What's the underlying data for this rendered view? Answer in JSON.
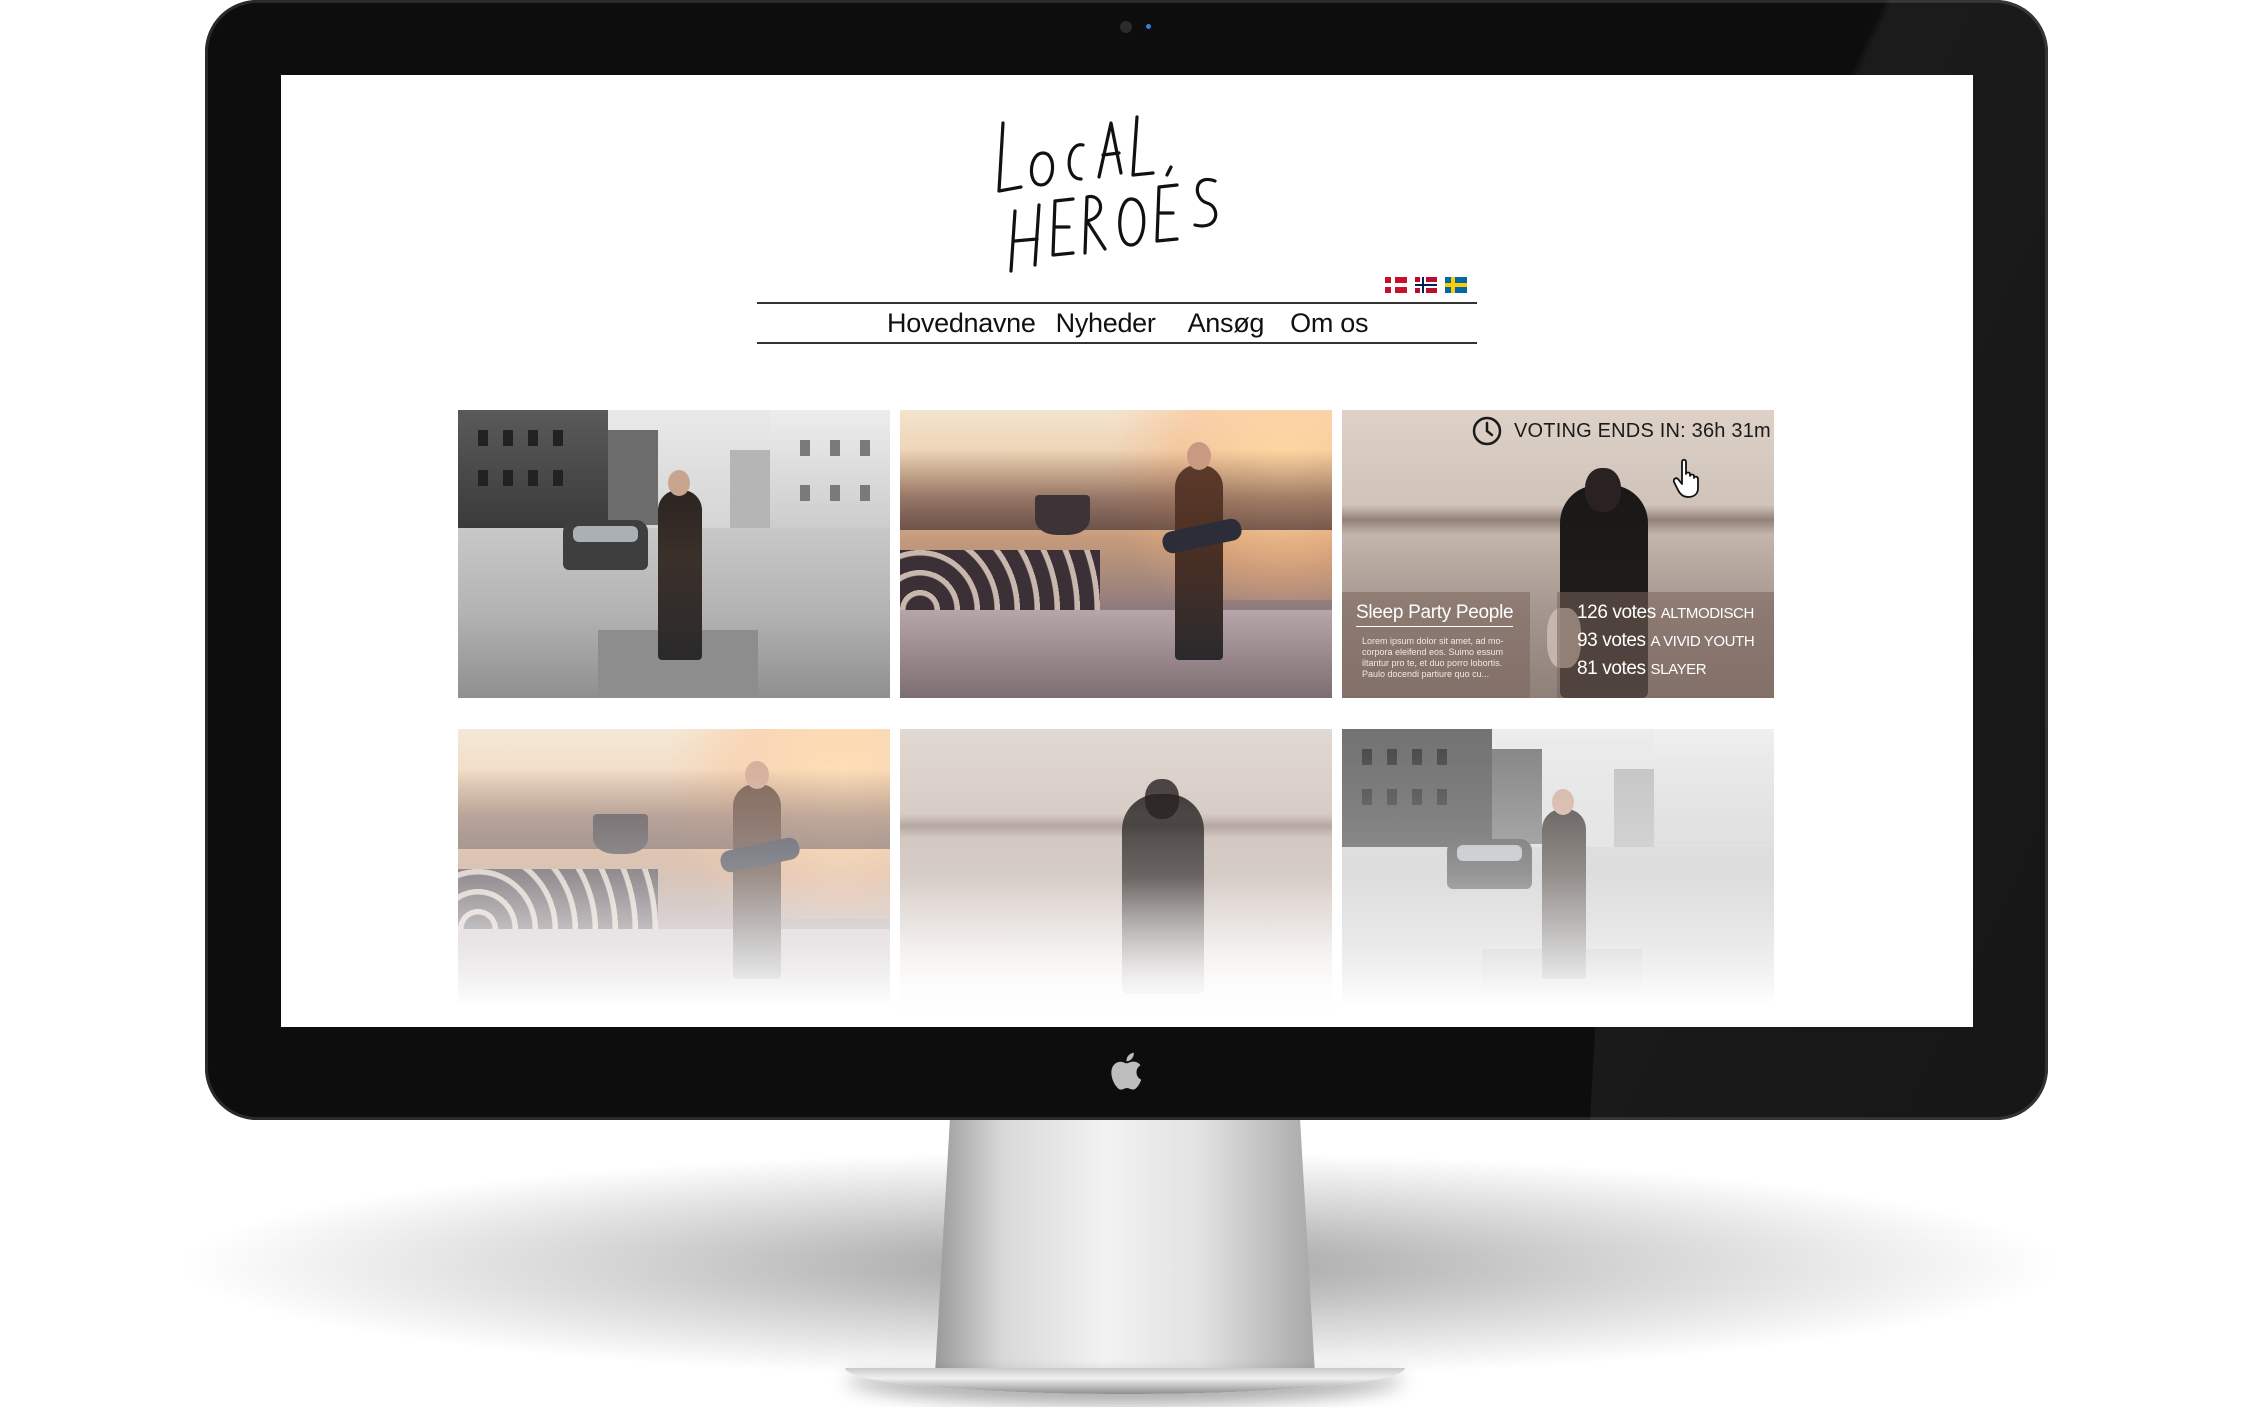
{
  "site": {
    "logo_text": "LOCAL HEROES",
    "languages": [
      {
        "code": "dk",
        "icon": "danish-flag-icon"
      },
      {
        "code": "no",
        "icon": "norwegian-flag-icon"
      },
      {
        "code": "se",
        "icon": "swedish-flag-icon"
      }
    ]
  },
  "nav": {
    "items": [
      "Hovednavne",
      "Nyheder",
      "Ansøg",
      "Om os"
    ]
  },
  "featured": {
    "voting_label": "VOTING ENDS IN: 36h 31m",
    "band_name": "Sleep Party People",
    "description": "Lorem ipsum dolor sit amet, ad mo-corpora eleifend eos. Suimo essum iltantur pro te, et duo porro lobortis. Paulo docendi partiure quo cu...",
    "votes": [
      {
        "count": "126 votes",
        "band": "ALTMODISCH"
      },
      {
        "count": "93 votes",
        "band": "A VIVID YOUTH"
      },
      {
        "count": "81 votes",
        "band": "SLAYER"
      }
    ]
  },
  "colors": {
    "bezel": "#0d0d0d",
    "screen_bg": "#ffffff",
    "nav_text": "#111111",
    "overlay": "rgba(120,98,90,0.55)"
  }
}
